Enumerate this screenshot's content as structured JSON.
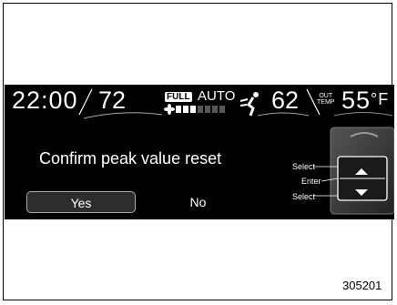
{
  "status": {
    "time": "22:00",
    "temp_left": "72",
    "fan_mode": "FULL",
    "climate_mode": "AUTO",
    "temp_right": "62",
    "out_label_line1": "OUT",
    "out_label_line2": "TEMP",
    "outside_temp": "55",
    "outside_unit": "°F",
    "fan_level_of_7": 3
  },
  "dialog": {
    "prompt": "Confirm peak value reset",
    "yes_label": "Yes",
    "no_label": "No"
  },
  "controls": {
    "select_top": "Select",
    "enter": "Enter",
    "select_bottom": "Select"
  },
  "figure_id": "305201",
  "colors": {
    "screen_bg": "#000000",
    "text": "#ffffff",
    "selected_button_bg": "#2d2d2d"
  },
  "icons": {
    "fan": "fan-icon",
    "airflow": "airflow-mode-icon",
    "up": "up-arrow-icon",
    "down": "down-arrow-icon",
    "switch": "switch-panel-icon"
  }
}
